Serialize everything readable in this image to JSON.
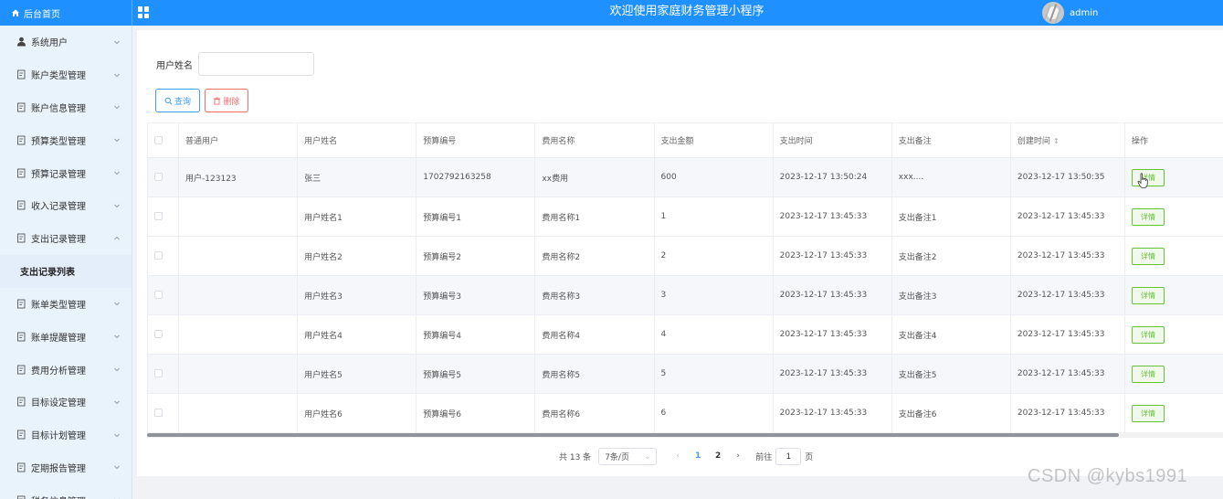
{
  "header": {
    "brand": "后台首页",
    "app_title": "欢迎使用家庭财务管理小程序",
    "username": "admin"
  },
  "sidebar": {
    "items": [
      {
        "label": "系统用户",
        "icon": "user-icon"
      },
      {
        "label": "账户类型管理",
        "icon": "document-icon"
      },
      {
        "label": "账户信息管理",
        "icon": "document-icon"
      },
      {
        "label": "预算类型管理",
        "icon": "document-icon"
      },
      {
        "label": "预算记录管理",
        "icon": "document-icon"
      },
      {
        "label": "收入记录管理",
        "icon": "document-icon"
      },
      {
        "label": "支出记录管理",
        "icon": "document-icon",
        "expanded": true
      },
      {
        "label": "账单类型管理",
        "icon": "document-icon"
      },
      {
        "label": "账单提醒管理",
        "icon": "document-icon"
      },
      {
        "label": "费用分析管理",
        "icon": "document-icon"
      },
      {
        "label": "目标设定管理",
        "icon": "document-icon"
      },
      {
        "label": "目标计划管理",
        "icon": "document-icon"
      },
      {
        "label": "定期报告管理",
        "icon": "document-icon"
      },
      {
        "label": "税务信息管理",
        "icon": "document-icon"
      }
    ],
    "active_sub": "支出记录列表"
  },
  "filter": {
    "label": "用户姓名",
    "value": "",
    "placeholder": ""
  },
  "buttons": {
    "search": "查询",
    "delete": "删除"
  },
  "table": {
    "columns": [
      "普通用户",
      "用户姓名",
      "预算编号",
      "费用名称",
      "支出金额",
      "支出时间",
      "支出备注",
      "创建时间",
      "操作"
    ],
    "sortable_column": "创建时间",
    "action_label": "详情",
    "rows": [
      [
        "用户-123123",
        "张三",
        "1702792163258",
        "xx费用",
        "600",
        "2023-12-17 13:50:24",
        "xxx....",
        "2023-12-17 13:50:35"
      ],
      [
        "",
        "用户姓名1",
        "预算编号1",
        "费用名称1",
        "1",
        "2023-12-17 13:45:33",
        "支出备注1",
        "2023-12-17 13:45:33"
      ],
      [
        "",
        "用户姓名2",
        "预算编号2",
        "费用名称2",
        "2",
        "2023-12-17 13:45:33",
        "支出备注2",
        "2023-12-17 13:45:33"
      ],
      [
        "",
        "用户姓名3",
        "预算编号3",
        "费用名称3",
        "3",
        "2023-12-17 13:45:33",
        "支出备注3",
        "2023-12-17 13:45:33"
      ],
      [
        "",
        "用户姓名4",
        "预算编号4",
        "费用名称4",
        "4",
        "2023-12-17 13:45:33",
        "支出备注4",
        "2023-12-17 13:45:33"
      ],
      [
        "",
        "用户姓名5",
        "预算编号5",
        "费用名称5",
        "5",
        "2023-12-17 13:45:33",
        "支出备注5",
        "2023-12-17 13:45:33"
      ],
      [
        "",
        "用户姓名6",
        "预算编号6",
        "费用名称6",
        "6",
        "2023-12-17 13:45:33",
        "支出备注6",
        "2023-12-17 13:45:33"
      ]
    ]
  },
  "pagination": {
    "total": "共 13 条",
    "page_size": "7条/页",
    "pages": [
      "1",
      "2"
    ],
    "current": "1",
    "goto_label": "前往",
    "goto_value": "1",
    "page_suffix": "页"
  },
  "watermark": "CSDN @kybs1991",
  "colors": {
    "header": "#1e90ff",
    "sidebar": "#e8f3fb",
    "primary": "#409eff",
    "danger": "#f56c6c",
    "success": "#67c23a"
  }
}
